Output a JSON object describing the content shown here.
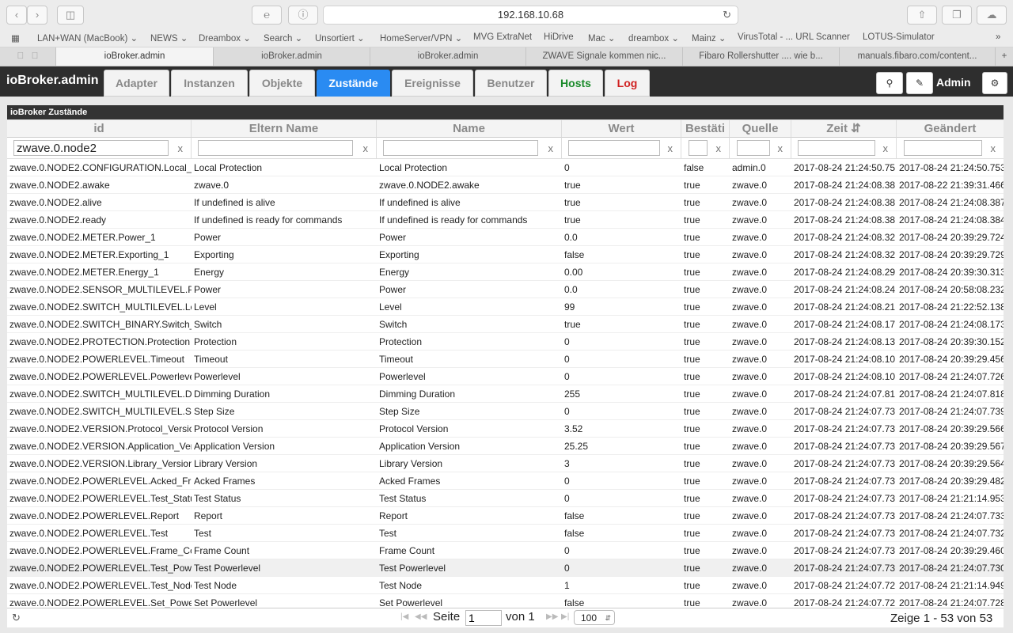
{
  "browser": {
    "url": "192.168.10.68",
    "bookmarks": [
      "LAN+WAN (MacBook) ⌄",
      "NEWS ⌄",
      "Dreambox ⌄",
      "Search ⌄",
      "Unsortiert ⌄",
      "HomeServer/VPN ⌄",
      "MVG ExtraNet",
      "HiDrive",
      "Mac ⌄",
      "dreambox ⌄",
      "Mainz ⌄",
      "VirusTotal - ... URL Scanner",
      "LOTUS-Simulator"
    ],
    "tabs": [
      "ioBroker.admin",
      "ioBroker.admin",
      "ioBroker.admin",
      "ZWAVE Signale kommen nic...",
      "Fibaro Rollershutter .... wie b...",
      "manuals.fibaro.com/content..."
    ]
  },
  "app": {
    "title": "ioBroker.admin",
    "user": "Admin",
    "nav": [
      "Adapter",
      "Instanzen",
      "Objekte",
      "Zustände",
      "Ereignisse",
      "Benutzer",
      "Hosts",
      "Log"
    ],
    "nav_colors": {
      "Hosts": "#1a8a2a",
      "Log": "#d02020"
    }
  },
  "grid": {
    "title": "ioBroker Zustände",
    "columns": [
      "id",
      "Eltern Name",
      "Name",
      "Wert",
      "Bestäti",
      "Quelle",
      "Zeit ⇵",
      "Geändert"
    ],
    "filter_id": "zwave.0.node2",
    "filter_clear": "x",
    "rows": [
      [
        "zwave.0.NODE2.CONFIGURATION.Local_",
        "Local Protection",
        "Local Protection",
        "0",
        "false",
        "admin.0",
        "2017-08-24 21:24:50.75",
        "2017-08-24 21:24:50.753"
      ],
      [
        "zwave.0.NODE2.awake",
        "zwave.0",
        "zwave.0.NODE2.awake",
        "true",
        "true",
        "zwave.0",
        "2017-08-24 21:24:08.38",
        "2017-08-22 21:39:31.466"
      ],
      [
        "zwave.0.NODE2.alive",
        "If undefined is alive",
        "If undefined is alive",
        "true",
        "true",
        "zwave.0",
        "2017-08-24 21:24:08.38",
        "2017-08-24 21:24:08.387"
      ],
      [
        "zwave.0.NODE2.ready",
        "If undefined is ready for commands",
        "If undefined is ready for commands",
        "true",
        "true",
        "zwave.0",
        "2017-08-24 21:24:08.38",
        "2017-08-24 21:24:08.384"
      ],
      [
        "zwave.0.NODE2.METER.Power_1",
        "Power",
        "Power",
        "0.0",
        "true",
        "zwave.0",
        "2017-08-24 21:24:08.32",
        "2017-08-24 20:39:29.724"
      ],
      [
        "zwave.0.NODE2.METER.Exporting_1",
        "Exporting",
        "Exporting",
        "false",
        "true",
        "zwave.0",
        "2017-08-24 21:24:08.32",
        "2017-08-24 20:39:29.729"
      ],
      [
        "zwave.0.NODE2.METER.Energy_1",
        "Energy",
        "Energy",
        "0.00",
        "true",
        "zwave.0",
        "2017-08-24 21:24:08.29",
        "2017-08-24 20:39:30.313"
      ],
      [
        "zwave.0.NODE2.SENSOR_MULTILEVEL.P",
        "Power",
        "Power",
        "0.0",
        "true",
        "zwave.0",
        "2017-08-24 21:24:08.24",
        "2017-08-24 20:58:08.232"
      ],
      [
        "zwave.0.NODE2.SWITCH_MULTILEVEL.Le",
        "Level",
        "Level",
        "99",
        "true",
        "zwave.0",
        "2017-08-24 21:24:08.21",
        "2017-08-24 21:22:52.138"
      ],
      [
        "zwave.0.NODE2.SWITCH_BINARY.Switch_",
        "Switch",
        "Switch",
        "true",
        "true",
        "zwave.0",
        "2017-08-24 21:24:08.17",
        "2017-08-24 21:24:08.173"
      ],
      [
        "zwave.0.NODE2.PROTECTION.Protection",
        "Protection",
        "Protection",
        "0",
        "true",
        "zwave.0",
        "2017-08-24 21:24:08.13",
        "2017-08-24 20:39:30.152"
      ],
      [
        "zwave.0.NODE2.POWERLEVEL.Timeout",
        "Timeout",
        "Timeout",
        "0",
        "true",
        "zwave.0",
        "2017-08-24 21:24:08.10",
        "2017-08-24 20:39:29.456"
      ],
      [
        "zwave.0.NODE2.POWERLEVEL.Powerleve",
        "Powerlevel",
        "Powerlevel",
        "0",
        "true",
        "zwave.0",
        "2017-08-24 21:24:08.10",
        "2017-08-24 21:24:07.726"
      ],
      [
        "zwave.0.NODE2.SWITCH_MULTILEVEL.D",
        "Dimming Duration",
        "Dimming Duration",
        "255",
        "true",
        "zwave.0",
        "2017-08-24 21:24:07.81",
        "2017-08-24 21:24:07.818"
      ],
      [
        "zwave.0.NODE2.SWITCH_MULTILEVEL.St",
        "Step Size",
        "Step Size",
        "0",
        "true",
        "zwave.0",
        "2017-08-24 21:24:07.73",
        "2017-08-24 21:24:07.739"
      ],
      [
        "zwave.0.NODE2.VERSION.Protocol_Versic",
        "Protocol Version",
        "Protocol Version",
        "3.52",
        "true",
        "zwave.0",
        "2017-08-24 21:24:07.73",
        "2017-08-24 20:39:29.566"
      ],
      [
        "zwave.0.NODE2.VERSION.Application_Ver",
        "Application Version",
        "Application Version",
        "25.25",
        "true",
        "zwave.0",
        "2017-08-24 21:24:07.73",
        "2017-08-24 20:39:29.567"
      ],
      [
        "zwave.0.NODE2.VERSION.Library_Version",
        "Library Version",
        "Library Version",
        "3",
        "true",
        "zwave.0",
        "2017-08-24 21:24:07.73",
        "2017-08-24 20:39:29.564"
      ],
      [
        "zwave.0.NODE2.POWERLEVEL.Acked_Fr",
        "Acked Frames",
        "Acked Frames",
        "0",
        "true",
        "zwave.0",
        "2017-08-24 21:24:07.73",
        "2017-08-24 20:39:29.482"
      ],
      [
        "zwave.0.NODE2.POWERLEVEL.Test_Statu",
        "Test Status",
        "Test Status",
        "0",
        "true",
        "zwave.0",
        "2017-08-24 21:24:07.73",
        "2017-08-24 21:21:14.953"
      ],
      [
        "zwave.0.NODE2.POWERLEVEL.Report",
        "Report",
        "Report",
        "false",
        "true",
        "zwave.0",
        "2017-08-24 21:24:07.73",
        "2017-08-24 21:24:07.733"
      ],
      [
        "zwave.0.NODE2.POWERLEVEL.Test",
        "Test",
        "Test",
        "false",
        "true",
        "zwave.0",
        "2017-08-24 21:24:07.73",
        "2017-08-24 21:24:07.732"
      ],
      [
        "zwave.0.NODE2.POWERLEVEL.Frame_Co",
        "Frame Count",
        "Frame Count",
        "0",
        "true",
        "zwave.0",
        "2017-08-24 21:24:07.73",
        "2017-08-24 20:39:29.460"
      ],
      [
        "zwave.0.NODE2.POWERLEVEL.Test_Pow",
        "Test Powerlevel",
        "Test Powerlevel",
        "0",
        "true",
        "zwave.0",
        "2017-08-24 21:24:07.73",
        "2017-08-24 21:24:07.730"
      ],
      [
        "zwave.0.NODE2.POWERLEVEL.Test_Node",
        "Test Node",
        "Test Node",
        "1",
        "true",
        "zwave.0",
        "2017-08-24 21:24:07.72",
        "2017-08-24 21:21:14.949"
      ],
      [
        "zwave.0.NODE2.POWERLEVEL.Set_Powe",
        "Set Powerlevel",
        "Set Powerlevel",
        "false",
        "true",
        "zwave.0",
        "2017-08-24 21:24:07.72",
        "2017-08-24 21:24:07.728"
      ]
    ],
    "selected_row": 23
  },
  "pager": {
    "seite_label": "Seite",
    "page": "1",
    "von_label": "von 1",
    "page_size": "100",
    "summary": "Zeige 1 - 53 von 53"
  }
}
